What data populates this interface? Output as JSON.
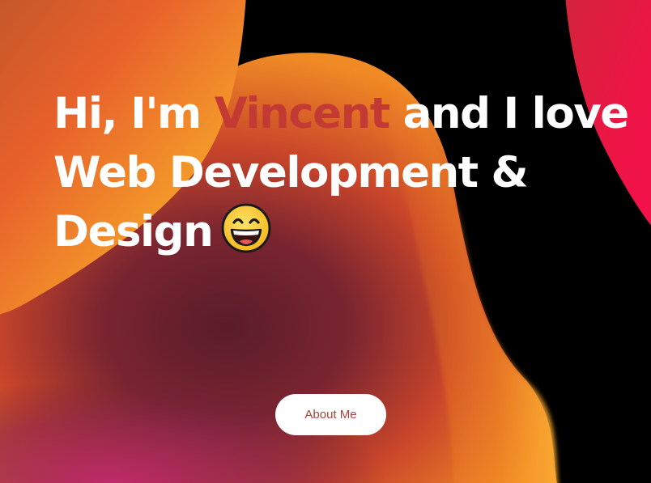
{
  "hero": {
    "greeting_prefix": "Hi, I'm ",
    "name": "Vincent",
    "line_rest": " and I love Web Development & Design",
    "emoji_icon": "grinning-face-emoji",
    "accent_color": "#c33a35"
  },
  "cta": {
    "about_label": "About Me"
  }
}
